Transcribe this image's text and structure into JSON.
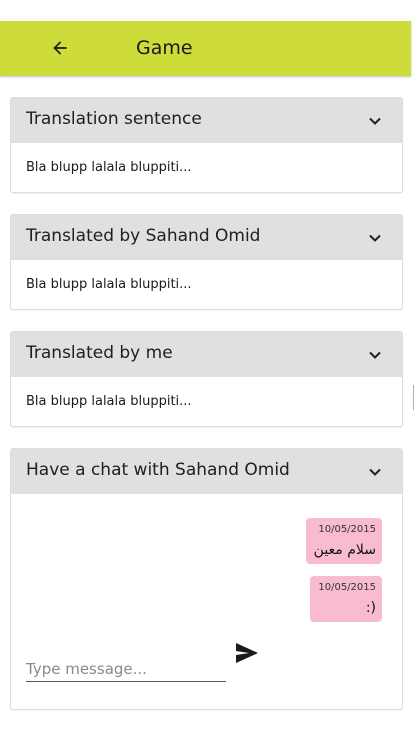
{
  "app_bar": {
    "title": "Game",
    "back_icon": "arrow-left-icon",
    "color": "#cddc39"
  },
  "panels": [
    {
      "title": "Translation sentence",
      "body": "Bla blupp lalala bluppiti...",
      "icon": "chevron-down-icon"
    },
    {
      "title": "Translated by Sahand Omid",
      "body": "Bla blupp lalala bluppiti...",
      "icon": "chevron-down-icon"
    },
    {
      "title": "Translated by me",
      "body": "Bla blupp lalala bluppiti...",
      "icon": "chevron-down-icon"
    }
  ],
  "chat": {
    "title": "Have a chat with Sahand Omid",
    "messages": [
      {
        "time": "10/05/2015",
        "text": "سلام معین"
      },
      {
        "time": "10/05/2015",
        "text": ":)"
      }
    ],
    "bubble_color": "#f8bbd0",
    "input_placeholder": "Type message...",
    "input_value": "",
    "send_icon": "send-icon"
  }
}
